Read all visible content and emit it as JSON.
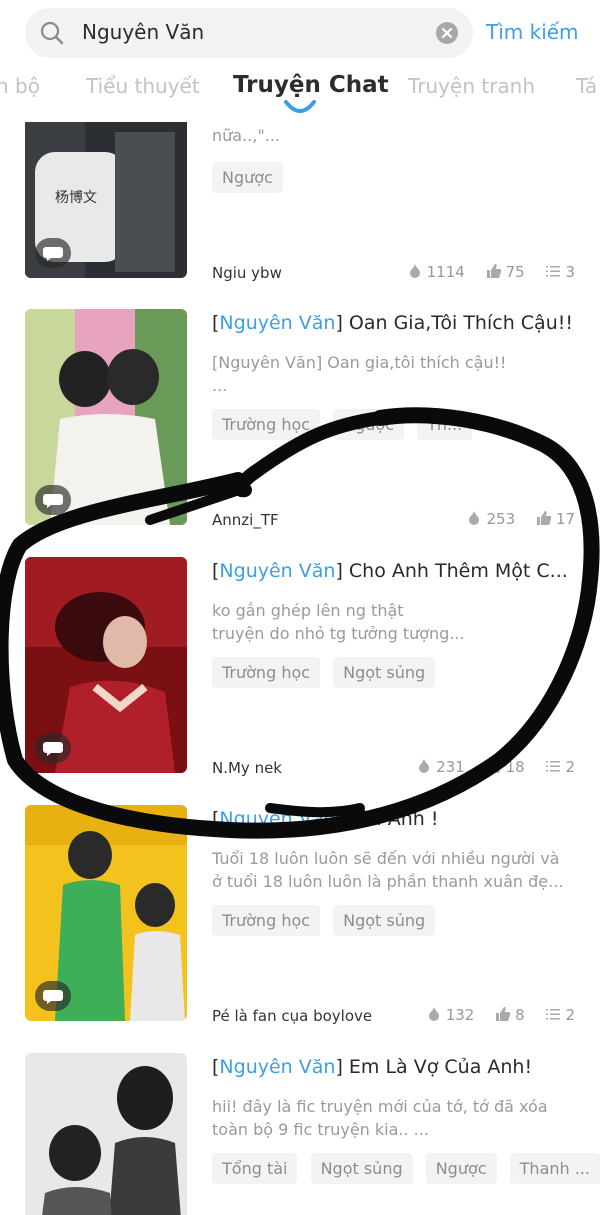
{
  "search": {
    "query": "Nguyên Văn",
    "button_label": "Tìm kiếm"
  },
  "tabs": [
    {
      "label": "n bộ",
      "active": false
    },
    {
      "label": "Tiểu thuyết",
      "active": false
    },
    {
      "label": "Truyện Chat",
      "active": true
    },
    {
      "label": "Truyện tranh",
      "active": false
    },
    {
      "label": "Tá",
      "active": false
    }
  ],
  "items": [
    {
      "title_keyword": "",
      "title_rest": "",
      "desc_lines": [
        "nữa..,\"..."
      ],
      "tags": [
        "Ngược"
      ],
      "author": "Ngiu ybw",
      "views": "1114",
      "likes": "75",
      "chapters": "3",
      "thumb_colors": [
        "#2b2f33",
        "#4a4e52"
      ]
    },
    {
      "title_keyword": "Nguyên Văn",
      "title_rest": " Oan Gia,Tôi Thích Cậu!!",
      "desc_lines": [
        "[Nguyên Văn] Oan gia,tôi thích cậu!!",
        "..."
      ],
      "tags": [
        "Trường học",
        "Ngược",
        "Th..."
      ],
      "author": "Annzi_TF",
      "views": "253",
      "likes": "17",
      "chapters": "",
      "thumb_colors": [
        "#e8a3c0",
        "#7aa86a"
      ]
    },
    {
      "title_keyword": "Nguyên Văn",
      "title_rest": " Cho Anh Thêm Một C...",
      "desc_lines": [
        "ko gắn ghép lên ng thật",
        "truyện do nhỏ tg tưởng tượng..."
      ],
      "tags": [
        "Trường học",
        "Ngọt sủng"
      ],
      "author": "N.My nek",
      "views": "231",
      "likes": "18",
      "chapters": "2",
      "thumb_colors": [
        "#7a0f14",
        "#c22830"
      ]
    },
    {
      "title_keyword": "Nguyên Văn",
      "title_rest": " Yêu Anh !",
      "desc_lines": [
        "Tuổi 18 luôn luôn sẽ đến với nhiều người và",
        "ở tuổi 18 luôn luôn là phần thanh xuân đẹ..."
      ],
      "tags": [
        "Trường học",
        "Ngọt sủng"
      ],
      "author": "Pé là fan cụa boylove",
      "views": "132",
      "likes": "8",
      "chapters": "2",
      "thumb_colors": [
        "#f3c21c",
        "#2f9a48"
      ]
    },
    {
      "title_keyword": "Nguyên Văn",
      "title_rest": " Em Là Vợ Của Anh!",
      "desc_lines": [
        "hii! đây là fic truyện mới của tớ, tớ đã xóa",
        "toàn bộ 9 fic truyện kia.. ..."
      ],
      "tags": [
        "Tổng tài",
        "Ngọt sủng",
        "Ngược",
        "Thanh ..."
      ],
      "author": "",
      "views": "",
      "likes": "",
      "chapters": "",
      "thumb_colors": [
        "#e8e8e8",
        "#3b3b3b"
      ]
    }
  ],
  "colors": {
    "accent": "#3a9fe8",
    "tag_bg": "#f3f3f3",
    "muted": "#9a9a9a"
  },
  "icons": {
    "search": "search-icon",
    "clear": "clear-icon",
    "chat": "chat-bubble-icon",
    "views": "flame-icon",
    "likes": "thumbs-up-icon",
    "chapters": "list-icon"
  }
}
